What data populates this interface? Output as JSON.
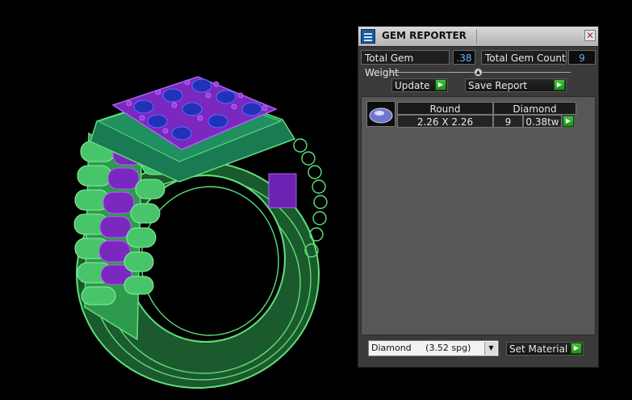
{
  "panel": {
    "title": "GEM REPORTER",
    "close_glyph": "✕",
    "total_weight_label": "Total Gem Weight",
    "total_weight_value": ".38",
    "total_count_label": "Total Gem Count",
    "total_count_value": "9",
    "update_label": "Update",
    "save_report_label": "Save Report",
    "table": {
      "headers": [
        "Round",
        "Diamond"
      ],
      "row": {
        "size": "2.26 X 2.26",
        "count": "9",
        "weight": "0.38tw"
      }
    },
    "material_value": "Diamond     (3.52 spg)",
    "set_material_label": "Set Material"
  },
  "icons": {
    "title_icon": "gem-reporter-icon",
    "play_arrow": "▶",
    "dropdown_arrow": "▼"
  },
  "colors": {
    "ring_wire": "#5fe07a",
    "ring_fill": "#33b45a",
    "prong": "#8a2fcf",
    "gem": "#2232b8",
    "accent_value": "#67b3ff"
  }
}
